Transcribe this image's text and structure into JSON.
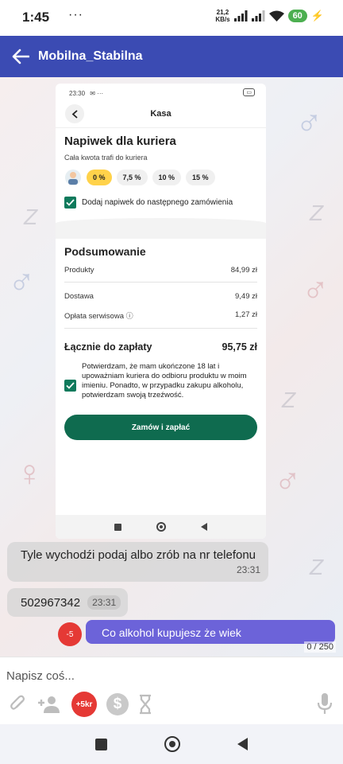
{
  "status_bar": {
    "time": "1:45",
    "dots": "···",
    "speed_value": "21,2",
    "speed_unit": "KB/s",
    "battery": "60"
  },
  "app_bar": {
    "title": "Mobilna_Stabilna"
  },
  "screenshot": {
    "status_time": "23:30",
    "status_icons": "✉ ···",
    "header_title": "Kasa",
    "tip_title": "Napiwek dla kuriera",
    "tip_subtitle": "Cała kwota trafi do kuriera",
    "tip_options": [
      "0 %",
      "7,5 %",
      "10 %",
      "15 %"
    ],
    "tip_selected_index": 0,
    "add_tip_label": "Dodaj napiwek do następnego zamówienia",
    "summary_title": "Podsumowanie",
    "products_label": "Produkty",
    "products_value": "84,99 zł",
    "delivery_label": "Dostawa",
    "delivery_value": "9,49 zł",
    "service_fee_label": "Opłata serwisowa",
    "service_fee_value": "1,27 zł",
    "total_label": "Łącznie do zapłaty",
    "total_value": "95,75 zł",
    "confirm_text": "Potwierdzam, że mam ukończone 18 lat i upoważniam kuriera do odbioru produktu w moim imieniu. Ponadto, w przypadku zakupu alkoholu, potwierdzam swoją trzeźwość.",
    "order_button": "Zamów i zapłać"
  },
  "messages": [
    {
      "text": "Tyle wychodźi podaj albo zrób na nr telefonu",
      "time": "23:31"
    },
    {
      "text": "502967342",
      "time": "23:31"
    },
    {
      "text": "Co alkohol kupujesz że wiek",
      "badge": "-5"
    }
  ],
  "composer": {
    "char_counter": "0 / 250",
    "placeholder": "Napisz coś...",
    "kr_button": "+5kr",
    "coin_symbol": "$"
  },
  "colors": {
    "app_bar": "#3b4bb3",
    "sent_bubble": "#6c63d9",
    "order_button": "#0f6b4f",
    "badge_red": "#e53935"
  }
}
